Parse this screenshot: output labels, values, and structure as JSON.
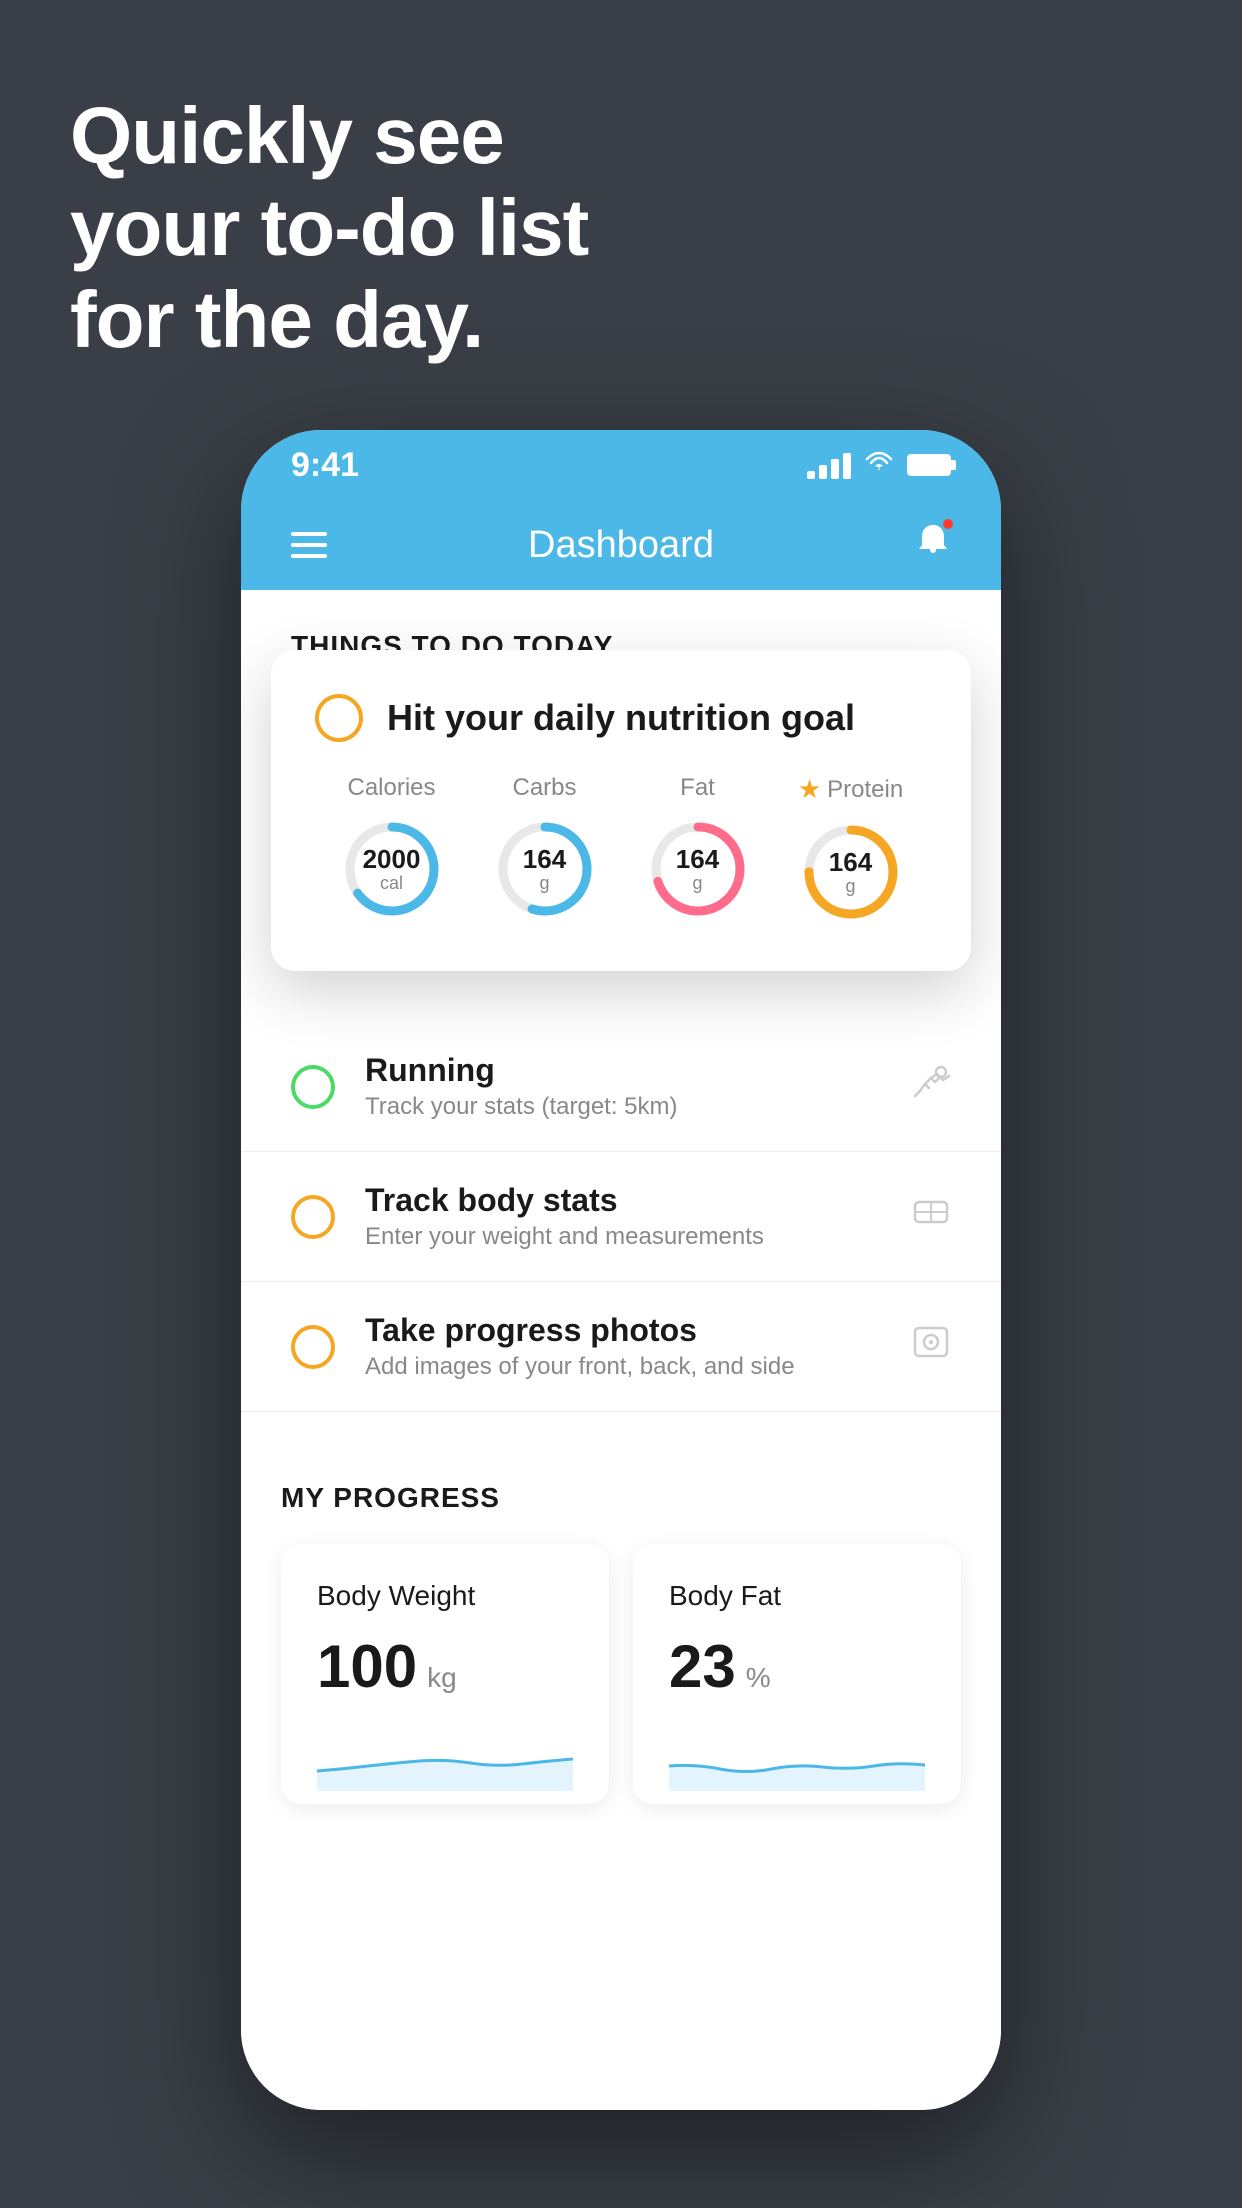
{
  "background": {
    "color": "#3a3f47"
  },
  "hero": {
    "line1": "Quickly see",
    "line2": "your to-do list",
    "line3": "for the day."
  },
  "phone": {
    "status_bar": {
      "time": "9:41"
    },
    "nav": {
      "title": "Dashboard"
    },
    "things_today": {
      "header": "THINGS TO DO TODAY"
    },
    "floating_card": {
      "title": "Hit your daily nutrition goal",
      "nutrition": [
        {
          "label": "Calories",
          "value": "2000",
          "unit": "cal",
          "color": "#4cb8e8",
          "progress": 0.65,
          "starred": false
        },
        {
          "label": "Carbs",
          "value": "164",
          "unit": "g",
          "color": "#4cb8e8",
          "progress": 0.55,
          "starred": false
        },
        {
          "label": "Fat",
          "value": "164",
          "unit": "g",
          "color": "#ff6b8a",
          "progress": 0.7,
          "starred": false
        },
        {
          "label": "Protein",
          "value": "164",
          "unit": "g",
          "color": "#f5a623",
          "progress": 0.75,
          "starred": true
        }
      ]
    },
    "todo_items": [
      {
        "name": "Running",
        "sub": "Track your stats (target: 5km)",
        "circle_color": "green",
        "icon": "👟"
      },
      {
        "name": "Track body stats",
        "sub": "Enter your weight and measurements",
        "circle_color": "yellow",
        "icon": "⚖"
      },
      {
        "name": "Take progress photos",
        "sub": "Add images of your front, back, and side",
        "circle_color": "yellow",
        "icon": "👤"
      }
    ],
    "progress": {
      "header": "MY PROGRESS",
      "cards": [
        {
          "title": "Body Weight",
          "value": "100",
          "unit": "kg"
        },
        {
          "title": "Body Fat",
          "value": "23",
          "unit": "%"
        }
      ]
    }
  }
}
